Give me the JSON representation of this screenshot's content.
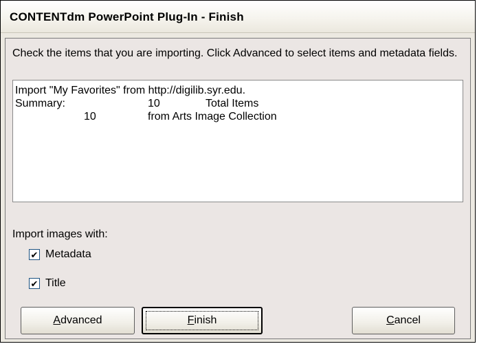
{
  "window": {
    "title": "CONTENTdm PowerPoint Plug-In - Finish"
  },
  "instructions": "Check the items that you are importing. Click Advanced to select items and metadata fields.",
  "summary": {
    "line1": "Import \"My Favorites\" from http://digilib.syr.edu.",
    "line2": {
      "label": "Summary:",
      "count": "10",
      "desc": "Total Items"
    },
    "line3": {
      "count": "10",
      "desc": "from Arts Image Collection"
    }
  },
  "import_options": {
    "label": "Import images with:",
    "metadata": {
      "label": "Metadata",
      "checked": true,
      "mark": "✔"
    },
    "title": {
      "label": "Title",
      "checked": true,
      "mark": "✔"
    }
  },
  "buttons": {
    "advanced": {
      "access_key": "A",
      "rest": "dvanced"
    },
    "finish": {
      "access_key": "F",
      "rest": "inish"
    },
    "cancel": {
      "access_key": "C",
      "rest": "ancel"
    }
  },
  "colors": {
    "dialog_bg": "#ebe6e4",
    "titlebar_bg": "#f6f4ee",
    "checkbox_border": "#1c5180"
  }
}
